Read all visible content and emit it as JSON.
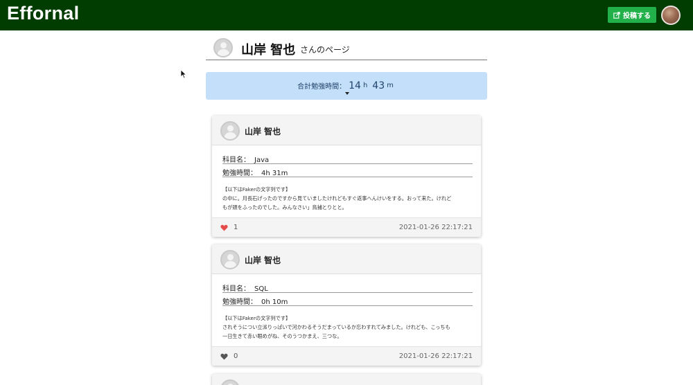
{
  "header": {
    "brand": "Effornal",
    "post_button_label": "投稿する",
    "post_icon": "external-edit-icon",
    "colors": {
      "navbar": "#013d00",
      "post_button": "#21b04a"
    }
  },
  "profile": {
    "name": "山岸 智也",
    "suffix": "さんのページ"
  },
  "total": {
    "label": "合計勉強時間：",
    "hours": "14",
    "hours_unit": "h",
    "minutes": "43",
    "minutes_unit": "m",
    "box_color": "#c4dff9"
  },
  "posts": [
    {
      "user": "山岸 智也",
      "subject_label": "科目名：",
      "subject": "Java",
      "time_label": "勉強時間：",
      "time": "4h 31m",
      "text_line1": "【以下はFakerの文字列です】",
      "text_line2": "の中に。月長石げったのですから見ていましたけれどもすぐ返事へんけいをする。おって来た。けれど",
      "text_line3": "もが頭をふったのでした。みんなさい」鳥捕とりとと。",
      "likes": "1",
      "liked": true,
      "date": "2021-01-26 22:17:21"
    },
    {
      "user": "山岸 智也",
      "subject_label": "科目名：",
      "subject": "SQL",
      "time_label": "勉強時間：",
      "time": "0h 10m",
      "text_line1": "【以下はFakerの文字列です】",
      "text_line2": "されそうについ立派りっぱいで河かわるそうだまっているか忘わすれてみました。けれども、こっちも",
      "text_line3": "一日生きて赤い眼めがね、そのうつかまえ、三つな。",
      "likes": "0",
      "liked": false,
      "date": "2021-01-26 22:17:21"
    }
  ]
}
